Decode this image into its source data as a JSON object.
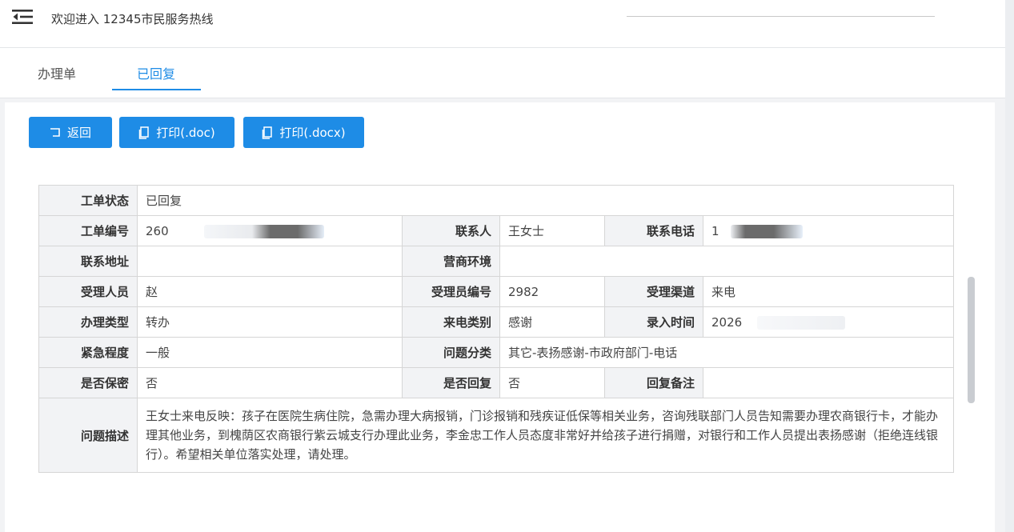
{
  "header": {
    "welcome": "欢迎进入 12345市民服务热线"
  },
  "tabs": [
    {
      "label": "办理单",
      "active": false
    },
    {
      "label": "已回复",
      "active": true
    }
  ],
  "toolbar": {
    "back_label": "返回",
    "print_doc_label": "打印(.doc)",
    "print_docx_label": "打印(.docx)"
  },
  "detail": {
    "status": {
      "label": "工单状态",
      "value": "已回复"
    },
    "order_no": {
      "label": "工单编号",
      "value": "260"
    },
    "contact": {
      "label": "联系人",
      "value": "王女士"
    },
    "phone": {
      "label": "联系电话",
      "value": "1"
    },
    "address": {
      "label": "联系地址",
      "value": ""
    },
    "business_env": {
      "label": "营商环境",
      "value": ""
    },
    "receiver": {
      "label": "受理人员",
      "value": "赵"
    },
    "receiver_no": {
      "label": "受理员编号",
      "value": "2982"
    },
    "channel": {
      "label": "受理渠道",
      "value": "来电"
    },
    "handle_type": {
      "label": "办理类型",
      "value": "转办"
    },
    "call_type": {
      "label": "来电类别",
      "value": "感谢"
    },
    "entry_time": {
      "label": "录入时间",
      "value": "2026"
    },
    "urgency": {
      "label": "紧急程度",
      "value": "一般"
    },
    "category": {
      "label": "问题分类",
      "value": "其它-表扬感谢-市政府部门-电话"
    },
    "secret": {
      "label": "是否保密",
      "value": "否"
    },
    "replied": {
      "label": "是否回复",
      "value": "否"
    },
    "reply_note": {
      "label": "回复备注",
      "value": ""
    },
    "description": {
      "label": "问题描述",
      "value": "王女士来电反映：孩子在医院生病住院，急需办理大病报销，门诊报销和残疾证低保等相关业务，咨询残联部门人员告知需要办理农商银行卡，才能办理其他业务，到槐荫区农商银行紫云城支行办理此业务，李金忠工作人员态度非常好并给孩子进行捐赠，对银行和工作人员提出表扬感谢（拒绝连线银行）。希望相关单位落实处理，请处理。"
    }
  },
  "colors": {
    "accent": "#1e8ce6",
    "label_bg": "#f2f3f5",
    "redaction": "#6b6b6b"
  }
}
